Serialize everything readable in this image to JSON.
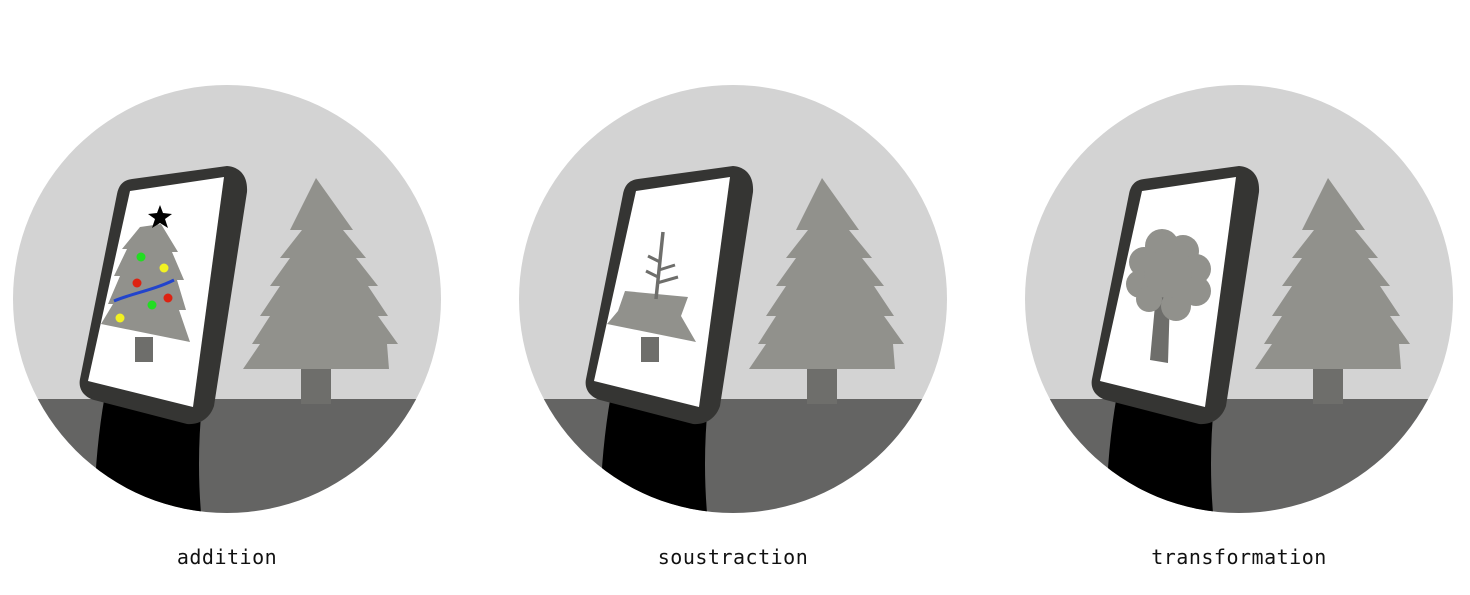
{
  "panels": [
    {
      "label": "addition",
      "screen_content": "decorated-fir-tree"
    },
    {
      "label": "soustraction",
      "screen_content": "stripped-fir-tree"
    },
    {
      "label": "transformation",
      "screen_content": "leafy-tree"
    }
  ],
  "colors": {
    "sky": "#d3d3d3",
    "ground": "#646463",
    "tree": "#91918c",
    "trunk": "#6e6e6b",
    "phone_frame": "#353533",
    "arm": "#000000",
    "ornament_green": "#22dd22",
    "ornament_yellow": "#f2f222",
    "ornament_red": "#dd2211",
    "garland": "#2244cc"
  }
}
